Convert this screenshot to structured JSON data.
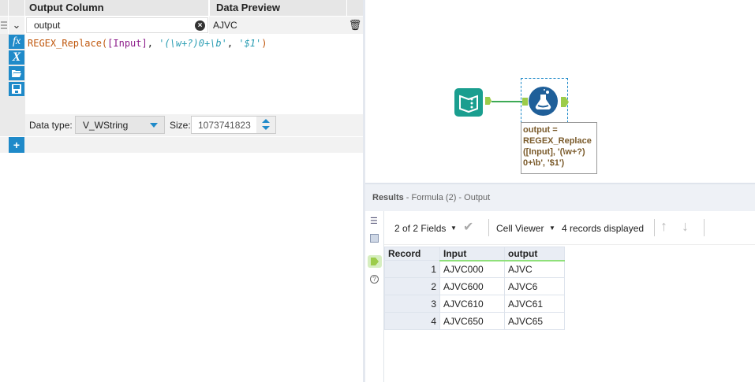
{
  "formula_panel": {
    "headers": {
      "output_column": "Output Column",
      "data_preview": "Data Preview"
    },
    "field_name": "output",
    "preview_value": "AJVC",
    "expression": {
      "func": "REGEX_Replace",
      "open": "(",
      "field": "[Input]",
      "sep1": ", ",
      "pattern": "'(\\w+?)0+\\b'",
      "sep2": ", ",
      "replacement": "'$1'",
      "close": ")"
    },
    "side_icons": {
      "fx": "fx",
      "var": "X"
    },
    "data_type_label": "Data type:",
    "data_type_value": "V_WString",
    "size_label": "Size:",
    "size_value": "1073741823",
    "add_label": "+"
  },
  "canvas": {
    "annotation": "output =\nREGEX_Replace\n([Input], '(\\w+?)\n0+\\b', '$1')"
  },
  "results": {
    "title": "Results",
    "subtitle": " - Formula (2) - Output",
    "fields": "2 of 2 Fields",
    "viewer": "Cell Viewer",
    "records_displayed": "4 records displayed",
    "columns": [
      "Record",
      "Input",
      "output"
    ],
    "rows": [
      [
        "1",
        "AJVC000",
        "AJVC"
      ],
      [
        "2",
        "AJVC600",
        "AJVC6"
      ],
      [
        "3",
        "AJVC610",
        "AJVC61"
      ],
      [
        "4",
        "AJVC650",
        "AJVC65"
      ]
    ]
  },
  "colors": {
    "accent": "#1f8ac9",
    "tool_green": "#8bc34a",
    "input_teal": "#1a9e8f",
    "formula_blue": "#1f5f99"
  }
}
